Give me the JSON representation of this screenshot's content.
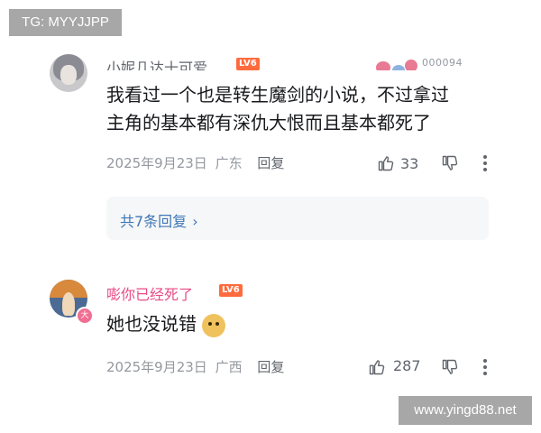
{
  "watermarks": {
    "top_left": "TG: MYYJJPP",
    "bottom_right": "www.yingd88.net"
  },
  "comments": [
    {
      "username": "小妮几达十可爱",
      "level": "LV6",
      "pendant_number": "000094",
      "text_lines": [
        "我看过一个也是转生魔剑的小说，不过拿过",
        "主角的基本都有深仇大恨而且基本都死了"
      ],
      "date": "2025年9月23日",
      "location": "广东",
      "reply_label": "回复",
      "likes": "33",
      "replies_summary": "共7条回复"
    },
    {
      "username": "嘭你已经死了",
      "level": "LV6",
      "avatar_badge": "大",
      "text": "她也没说错",
      "emoji": "doge-emoji",
      "date": "2025年9月23日",
      "location": "广西",
      "reply_label": "回复",
      "likes": "287"
    }
  ],
  "icons": [
    "like-icon",
    "dislike-icon",
    "more-icon",
    "chevron-right-icon"
  ],
  "colors": {
    "vip_name": "#e84b85",
    "link": "#3e77b5",
    "level_badge": "#ff6b3d"
  }
}
